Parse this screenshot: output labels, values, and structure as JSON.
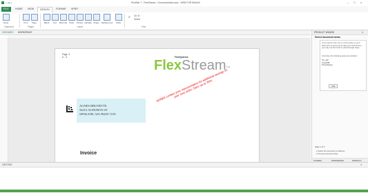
{
  "window": {
    "title": "PrintNet T - FlexStream - Dmoreverbatim.wsc - WEB FOR BDAN3",
    "controls": [
      "–",
      "□",
      "×"
    ]
  },
  "ribbon_tabs": [
    "FILE",
    "HOME",
    "VIEW",
    "DESIGN",
    "FORMAT",
    "SPRIT"
  ],
  "ribbon": {
    "groups": [
      "Clipboard",
      "Pages",
      "Insert",
      "Find"
    ],
    "buttons": [
      "Paste",
      "Print",
      "Page",
      "Blank",
      "Text",
      "Barcode",
      "Chart",
      "Picture",
      "Variable",
      "Shape",
      "Background",
      "Table"
    ],
    "find_items": [
      "Go To",
      "Select"
    ]
  },
  "doc_tab": "SCENARIO",
  "doc_tab2": "WORKSPACE",
  "page": {
    "small_header_line1": "Page: 3",
    "small_header_line2": "U - 3",
    "brand_small": "FlexSystems",
    "logo_left": "Flex",
    "logo_right": "Stream",
    "tm": "TM",
    "address_line1": "AGNES BRUNETTE",
    "address_line2": "56213 AUDUBON ST",
    "address_line3": "SPOKANE, WA 99205-7219",
    "promo": "AGNES contact your representative for additional savings on your next order. Save up to 25%.",
    "invoice": "Invoice"
  },
  "right_panel": {
    "header": "PRODUCT WIZARD",
    "section_title": "Select document areas",
    "intro": "If you want to see one or more areas on your document to group and make your final docum, you may use the tools in panel though steps.",
    "list_label": "Currently, the following areas are defined:",
    "areas": [
      "frm_Adr",
      "CustLOB",
      "PromoName"
    ],
    "add_label": "Add",
    "step_label": "Step 1 of 1",
    "step_items": [
      "Select the document & address",
      "Process document files"
    ],
    "footer_tabs": [
      "SCHEMA",
      "PROPERTIES",
      "PRODUCT"
    ]
  },
  "bottom_panel": {
    "title": "LOG FILE"
  },
  "colors": {
    "accent": "#2e8b57",
    "logo_gray": "#9a9a9a",
    "logo_green": "#8cc63f",
    "address_bg": "#d9f1f6",
    "promo": "#e60000",
    "status": "#53a34f"
  }
}
